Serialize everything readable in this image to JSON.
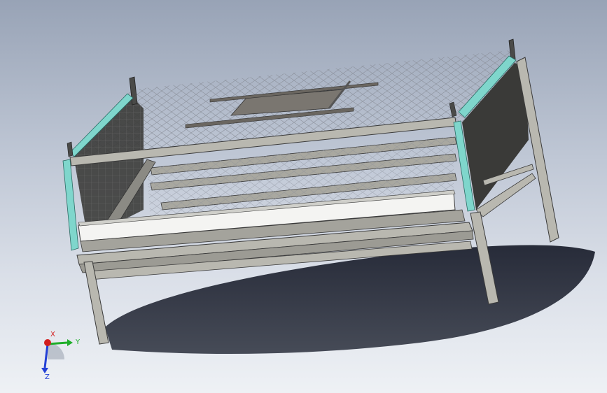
{
  "viewport": {
    "background_top": "#98a3b6",
    "background_bottom": "#eef1f5"
  },
  "model": {
    "frame_color": "#b9b8b0",
    "frame_edge": "#3a3a3a",
    "accent_color": "#7fd6cc",
    "panel_color": "#3c3c3a",
    "trough_color": "#f4f4f2",
    "mesh_color": "#8a8f99"
  },
  "triad": {
    "x_label": "X",
    "y_label": "Y",
    "z_label": "Z",
    "x_color": "#d21e1e",
    "y_color": "#1fae2a",
    "z_color": "#2340d6"
  }
}
